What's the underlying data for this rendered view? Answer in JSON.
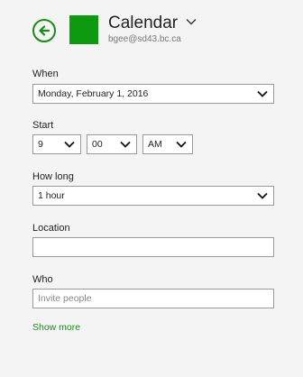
{
  "header": {
    "calendar_name": "Calendar",
    "account": "bgee@sd43.bc.ca",
    "accent_color": "#0e9a0e"
  },
  "when": {
    "label": "When",
    "value": "Monday, February 1, 2016"
  },
  "start": {
    "label": "Start",
    "hour": "9",
    "minute": "00",
    "ampm": "AM"
  },
  "how_long": {
    "label": "How long",
    "value": "1 hour"
  },
  "location": {
    "label": "Location",
    "value": ""
  },
  "who": {
    "label": "Who",
    "placeholder": "Invite people"
  },
  "show_more": "Show more"
}
